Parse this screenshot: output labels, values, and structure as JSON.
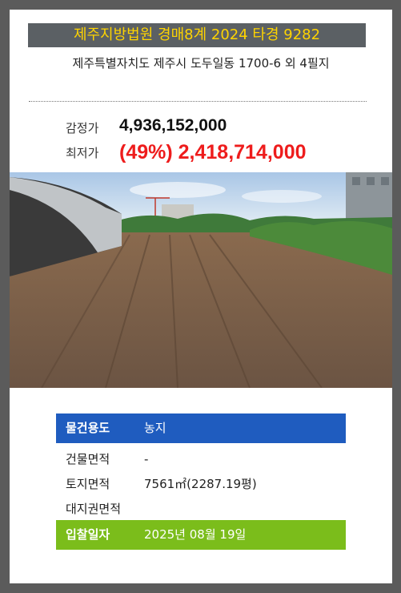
{
  "auction": {
    "court_case": "제주지방법원 경매8계 2024 타경 9282",
    "address": "제주특별자치도 제주시 도두일동 1700-6 외 4필지"
  },
  "price": {
    "appraisal_label": "감정가",
    "appraisal_value": "4,936,152,000",
    "minimum_label": "최저가",
    "minimum_value": "(49%) 2,418,714,000"
  },
  "details": {
    "usage_label": "물건용도",
    "usage_value": "농지",
    "building_area_label": "건물면적",
    "building_area_value": "-",
    "land_area_label": "토지면적",
    "land_area_value": "7561㎡(2287.19평)",
    "land_right_label": "대지권면적",
    "land_right_value": "",
    "bid_date_label": "입찰일자",
    "bid_date_value": "2025년 08월 19일"
  },
  "colors": {
    "court_text": "#ffd400",
    "minimum_price": "#ee1c1c",
    "usage_row": "#1f5cbf",
    "bid_row": "#7bbd1b"
  }
}
